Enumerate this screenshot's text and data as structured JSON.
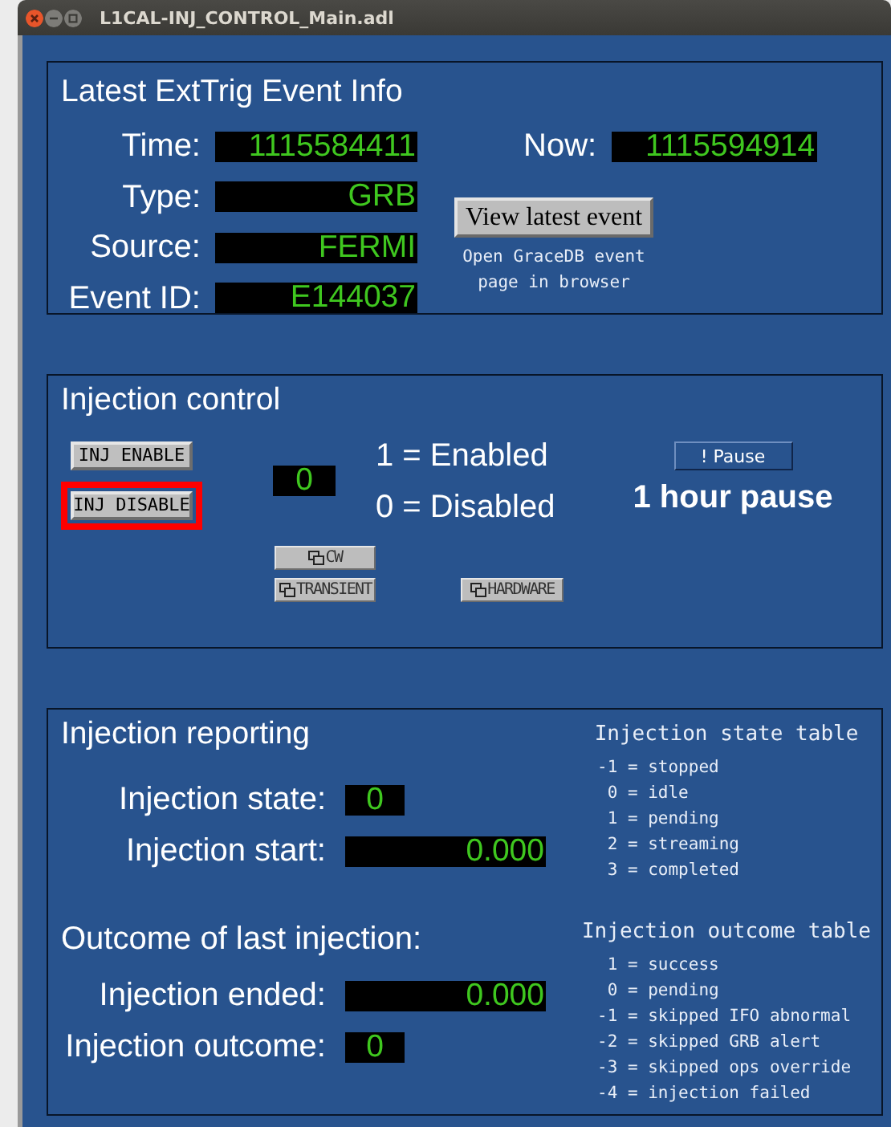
{
  "window": {
    "title": "L1CAL-INJ_CONTROL_Main.adl"
  },
  "event_info": {
    "title": "Latest ExtTrig Event Info",
    "fields": [
      {
        "label": "Time:",
        "value": "1115584411"
      },
      {
        "label": "Type:",
        "value": "GRB"
      },
      {
        "label": "Source:",
        "value": "FERMI"
      },
      {
        "label": "Event ID:",
        "value": "E144037"
      }
    ],
    "now": {
      "label": "Now:",
      "value": "1115594914"
    },
    "view_button": "View latest event",
    "view_caption": [
      "Open GraceDB event",
      "page in browser"
    ]
  },
  "injection_control": {
    "title": "Injection control",
    "buttons": [
      {
        "label": "INJ ENABLE",
        "selected": false
      },
      {
        "label": "INJ DISABLE",
        "selected": true
      }
    ],
    "value": "0",
    "legend": [
      "1 = Enabled",
      "0 = Disabled"
    ],
    "pause_button": "! Pause",
    "pause_label": "1 hour pause",
    "related_displays": [
      {
        "label": "CW"
      },
      {
        "label": "TRANSIENT"
      },
      {
        "label": "HARDWARE"
      }
    ]
  },
  "injection_reporting": {
    "title": "Injection reporting",
    "state": {
      "label": "Injection state:",
      "value": "0"
    },
    "start": {
      "label": "Injection start:",
      "value": "0.000"
    },
    "outcome_heading": "Outcome of last injection:",
    "ended": {
      "label": "Injection ended:",
      "value": "0.000"
    },
    "outcome": {
      "label": "Injection outcome:",
      "value": "0"
    },
    "state_table": {
      "title": "Injection state table",
      "entries": [
        {
          "code": "-1",
          "meaning": "= stopped"
        },
        {
          "code": "0",
          "meaning": "= idle"
        },
        {
          "code": "1",
          "meaning": "= pending"
        },
        {
          "code": "2",
          "meaning": "= streaming"
        },
        {
          "code": "3",
          "meaning": "= completed"
        }
      ]
    },
    "outcome_table": {
      "title": "Injection outcome table",
      "entries": [
        {
          "code": "1",
          "meaning": "= success"
        },
        {
          "code": "0",
          "meaning": "= pending"
        },
        {
          "code": "-1",
          "meaning": "= skipped IFO abnormal"
        },
        {
          "code": "-2",
          "meaning": "= skipped GRB alert"
        },
        {
          "code": "-3",
          "meaning": "= skipped ops override"
        },
        {
          "code": "-4",
          "meaning": "= injection failed"
        }
      ]
    }
  }
}
